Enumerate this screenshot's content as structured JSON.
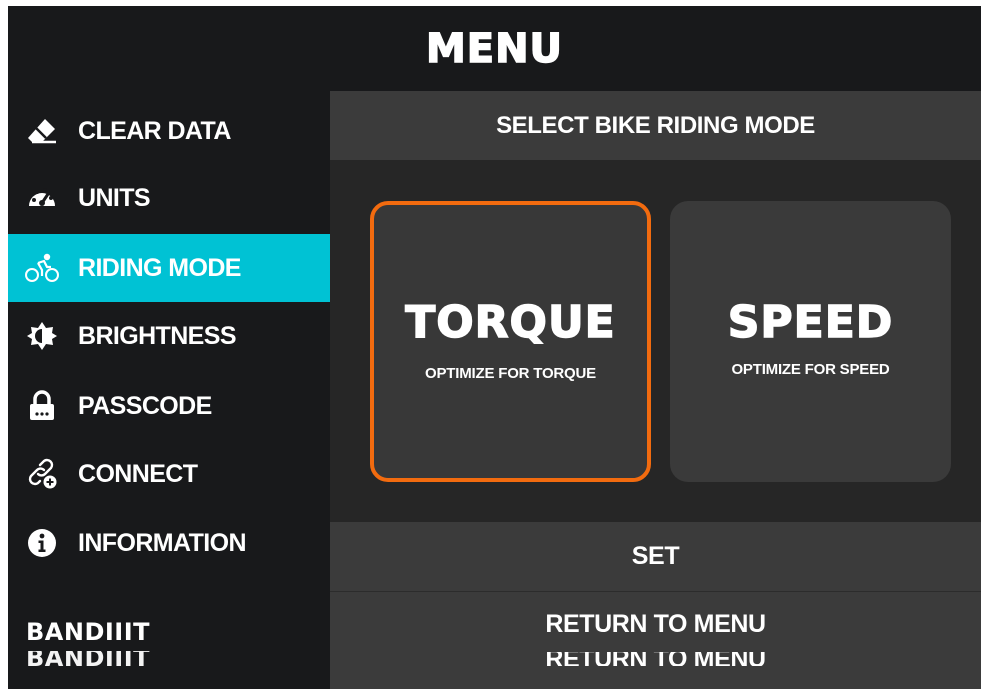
{
  "header": {
    "title": "MENU"
  },
  "sidebar": {
    "items": [
      {
        "label": "CLEAR DATA",
        "icon": "eraser-icon"
      },
      {
        "label": "UNITS",
        "icon": "speedometer-icon"
      },
      {
        "label": "RIDING MODE",
        "icon": "cyclist-icon",
        "active": true
      },
      {
        "label": "BRIGHTNESS",
        "icon": "brightness-icon"
      },
      {
        "label": "PASSCODE",
        "icon": "lock-icon"
      },
      {
        "label": "CONNECT",
        "icon": "link-icon"
      },
      {
        "label": "INFORMATION",
        "icon": "info-icon"
      }
    ],
    "brand": "BANDIIIT",
    "brand_ghost": "BANDIIIT"
  },
  "main": {
    "title": "SELECT BIKE RIDING MODE",
    "modes": [
      {
        "title": "TORQUE",
        "subtitle": "OPTIMIZE FOR TORQUE",
        "selected": true
      },
      {
        "title": "SPEED",
        "subtitle": "OPTIMIZE FOR SPEED",
        "selected": false
      }
    ],
    "set_label": "SET",
    "return_label": "RETURN TO MENU",
    "return_ghost": "RETURN TO MENU"
  },
  "colors": {
    "background": "#18191b",
    "panel": "#262626",
    "bar": "#3b3b3b",
    "accent_active": "#00c2d4",
    "selected_border": "#f26b0f"
  }
}
